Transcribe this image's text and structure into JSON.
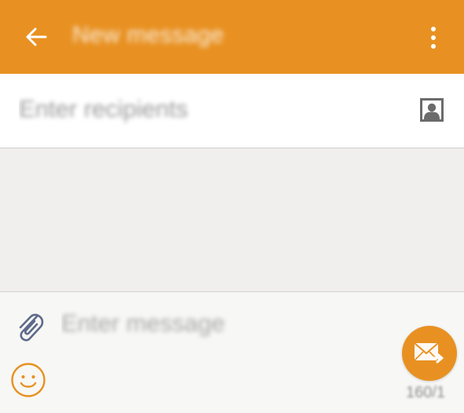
{
  "header": {
    "title": "New message",
    "back_icon": "arrow-left-icon",
    "menu_icon": "more-vert-icon"
  },
  "recipients": {
    "placeholder": "Enter recipients",
    "contact_icon": "contact-picker-icon"
  },
  "composer": {
    "placeholder": "Enter message",
    "attach_icon": "paperclip-icon",
    "emoji_icon": "smiley-icon",
    "send_icon": "send-envelope-icon",
    "char_count": "160/1"
  },
  "colors": {
    "accent": "#e89122",
    "header_text": "#ffffff",
    "background": "#f0efed",
    "composer_bg": "#f7f7f5"
  }
}
